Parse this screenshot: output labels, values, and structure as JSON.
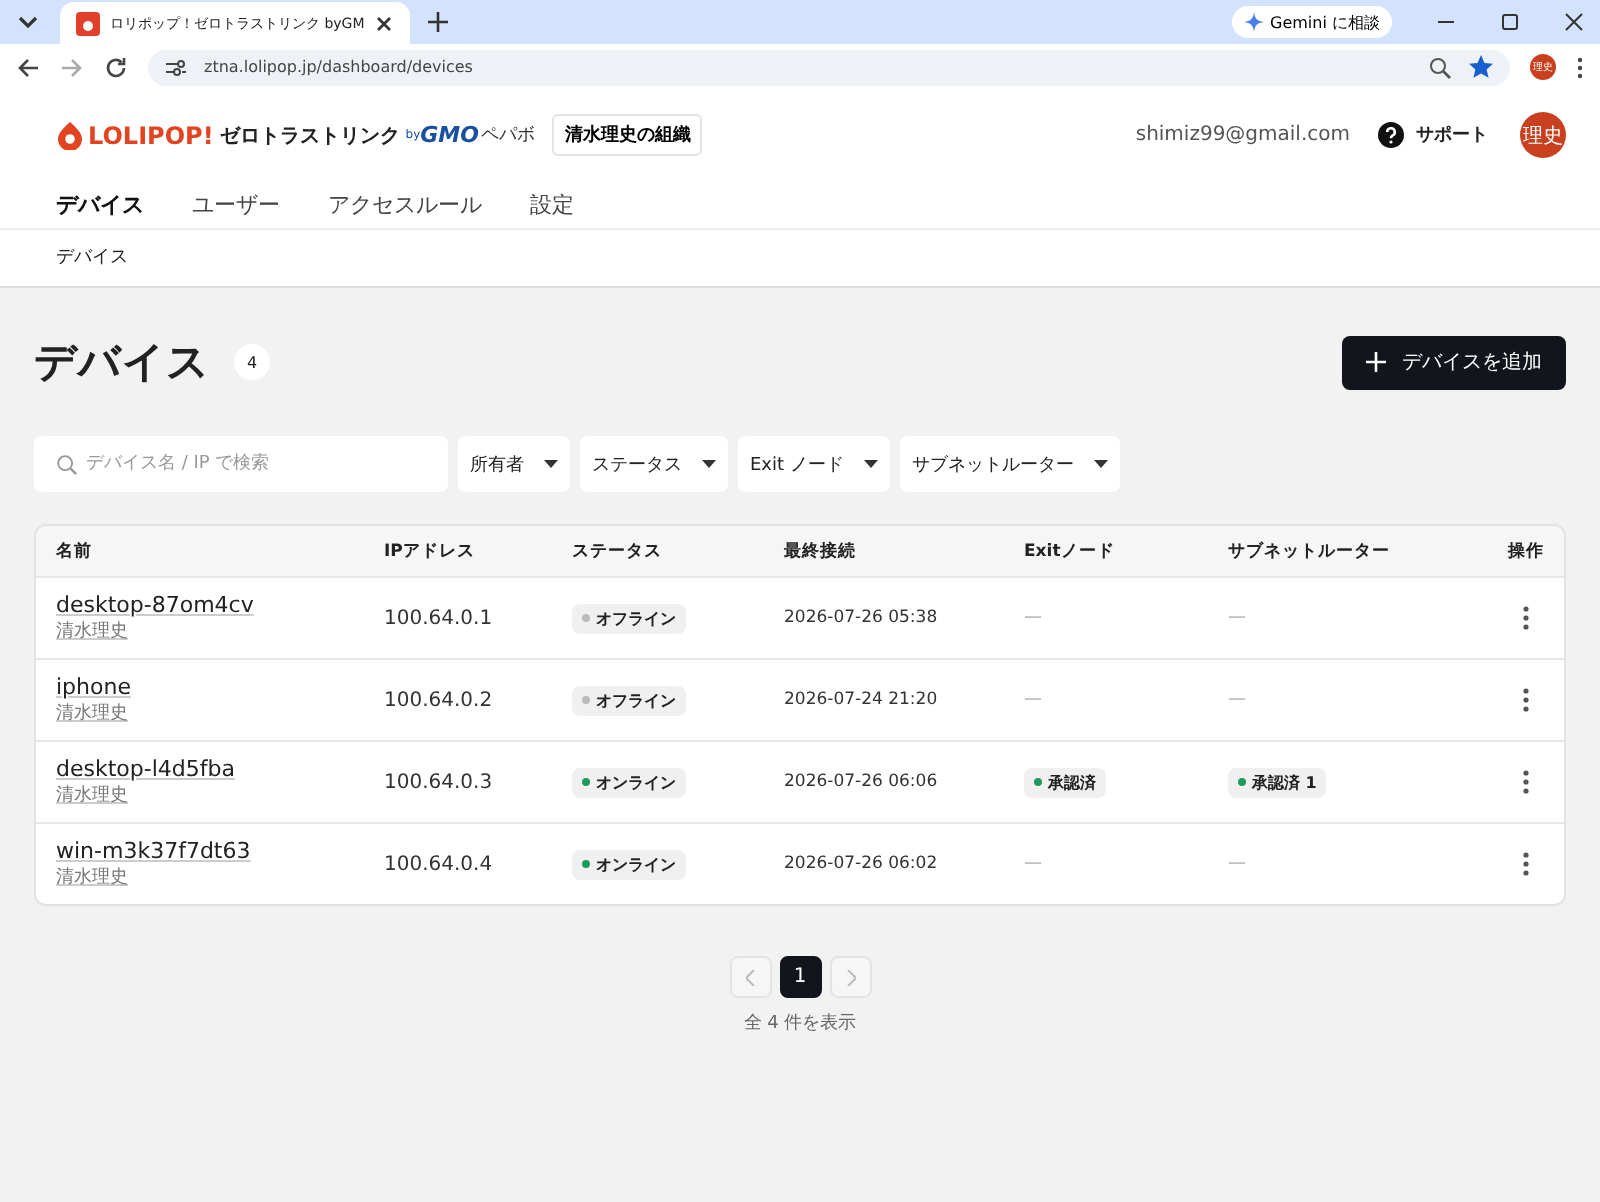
{
  "browser": {
    "tab_title": "ロリポップ！ゼロトラストリンク byGM",
    "address": "ztna.lolipop.jp/dashboard/devices",
    "gemini_button": "Gemini に相談",
    "profile_initials": "理史"
  },
  "header": {
    "logo_brand": "LOLIPOP!",
    "logo_product": "ゼロトラストリンク",
    "logo_by": "by",
    "logo_company": "GMO",
    "logo_company_kana": "ペパボ",
    "organization": "清水理史の組織",
    "email": "shimiz99@gmail.com",
    "support": "サポート",
    "avatar": "理史"
  },
  "nav": [
    {
      "label": "デバイス",
      "selected": true
    },
    {
      "label": "ユーザー",
      "selected": false
    },
    {
      "label": "アクセスルール",
      "selected": false
    },
    {
      "label": "設定",
      "selected": false
    }
  ],
  "sub_tabs": [
    {
      "label": "デバイス",
      "selected": true
    }
  ],
  "page": {
    "title": "デバイス",
    "count": "4",
    "add_button": "デバイスを追加"
  },
  "search": {
    "placeholder": "デバイス名 / IP で検索"
  },
  "filters": [
    "所有者",
    "ステータス",
    "Exit ノード",
    "サブネットルーター"
  ],
  "table": {
    "columns": [
      "名前",
      "IPアドレス",
      "ステータス",
      "最終接続",
      "Exitノード",
      "サブネットルーター",
      "操作"
    ],
    "rows": [
      {
        "name": "desktop-87om4cv",
        "owner": "清水理史",
        "ip": "100.64.0.1",
        "status": "オフライン",
        "online": false,
        "last": "2026-07-26 05:38",
        "exit": {
          "kind": "none",
          "text": "—"
        },
        "subnet": {
          "kind": "none",
          "text": "—"
        }
      },
      {
        "name": "iphone",
        "owner": "清水理史",
        "ip": "100.64.0.2",
        "status": "オフライン",
        "online": false,
        "last": "2026-07-24 21:20",
        "exit": {
          "kind": "none",
          "text": "—"
        },
        "subnet": {
          "kind": "none",
          "text": "—"
        }
      },
      {
        "name": "desktop-l4d5fba",
        "owner": "清水理史",
        "ip": "100.64.0.3",
        "status": "オンライン",
        "online": true,
        "last": "2026-07-26 06:06",
        "exit": {
          "kind": "badge",
          "text": "承認済"
        },
        "subnet": {
          "kind": "badge",
          "text": "承認済 1"
        }
      },
      {
        "name": "win-m3k37f7dt63",
        "owner": "清水理史",
        "ip": "100.64.0.4",
        "status": "オンライン",
        "online": true,
        "last": "2026-07-26 06:02",
        "exit": {
          "kind": "none",
          "text": "—"
        },
        "subnet": {
          "kind": "none",
          "text": "—"
        }
      }
    ]
  },
  "pagination": {
    "prev_disabled": true,
    "next_disabled": true,
    "pages": [
      {
        "label": "1",
        "selected": true
      }
    ],
    "summary": "全 4 件を表示"
  }
}
